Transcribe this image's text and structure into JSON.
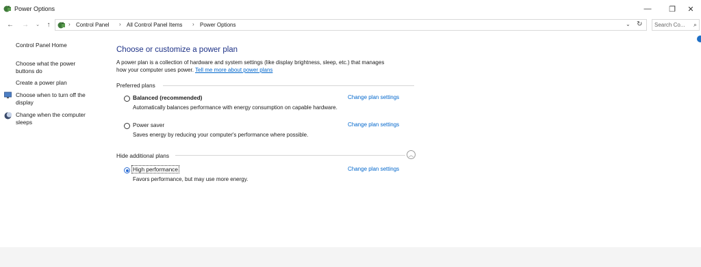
{
  "window": {
    "title": "Power Options",
    "minimize": "—",
    "maximize": "❐",
    "close": "✕"
  },
  "nav": {
    "back": "←",
    "forward": "→",
    "recent": "⌄",
    "up": "↑",
    "breadcrumbs": [
      "Control Panel",
      "All Control Panel Items",
      "Power Options"
    ],
    "separator": "›",
    "dropdown": "⌄",
    "refresh": "↻",
    "search_placeholder": "Search Co...",
    "search_icon": "⌕"
  },
  "sidebar": {
    "home": "Control Panel Home",
    "items": [
      {
        "line1": "Choose what the power",
        "line2": "buttons do"
      },
      {
        "line1": "Create a power plan",
        "line2": ""
      },
      {
        "line1": "Choose when to turn off the",
        "line2": "display",
        "icon": "monitor-icon"
      },
      {
        "line1": "Change when the computer",
        "line2": "sleeps",
        "icon": "moon-icon"
      }
    ]
  },
  "main": {
    "title": "Choose or customize a power plan",
    "desc_line1": "A power plan is a collection of hardware and system settings (like display brightness, sleep, etc.) that manages",
    "desc_line2": "how your computer uses power.",
    "tell_me_more": "Tell me more about power plans",
    "preferred_label": "Preferred plans",
    "hide_label": "Hide additional plans",
    "collapse_icon": "︿",
    "change_label": "Change plan settings",
    "plans": [
      {
        "name": "Balanced (recommended)",
        "desc": "Automatically balances performance with energy consumption on capable hardware.",
        "selected": false
      },
      {
        "name": "Power saver",
        "desc": "Saves energy by reducing your computer's performance where possible.",
        "selected": false
      },
      {
        "name": "High performance",
        "desc": "Favors performance, but may use more energy.",
        "selected": true
      }
    ]
  },
  "colors": {
    "title": "#1e3287",
    "link": "#0066cc",
    "radio_selected": "#2b6cd4"
  }
}
